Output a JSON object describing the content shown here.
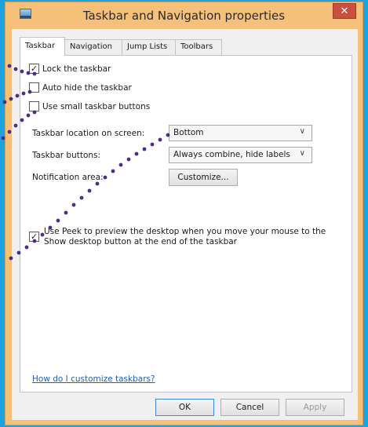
{
  "window": {
    "title": "Taskbar and Navigation properties"
  },
  "tabs": [
    "Taskbar",
    "Navigation",
    "Jump Lists",
    "Toolbars"
  ],
  "taskbar": {
    "lock": {
      "label": "Lock the taskbar",
      "checked": true
    },
    "autohide": {
      "label": "Auto hide the taskbar",
      "checked": false
    },
    "small_buttons": {
      "label": "Use small taskbar buttons",
      "checked": false
    },
    "location_label": "Taskbar location on screen:",
    "location_value": "Bottom",
    "buttons_label": "Taskbar buttons:",
    "buttons_value": "Always combine, hide labels",
    "notification_label": "Notification area:",
    "customize_label": "Customize...",
    "peek": {
      "label": "Use Peek to preview the desktop when you move your mouse to the Show desktop button at the end of the taskbar",
      "checked": true
    },
    "help_link": "How do I customize taskbars?"
  },
  "footer": {
    "ok": "OK",
    "cancel": "Cancel",
    "apply": "Apply"
  },
  "icons": {
    "check": "✓",
    "chevron": "∨",
    "close": "✕"
  },
  "colors": {
    "background": "#1aa3df",
    "frame": "#f5c17a",
    "close": "#c7503f",
    "link": "#1f5fb5"
  }
}
